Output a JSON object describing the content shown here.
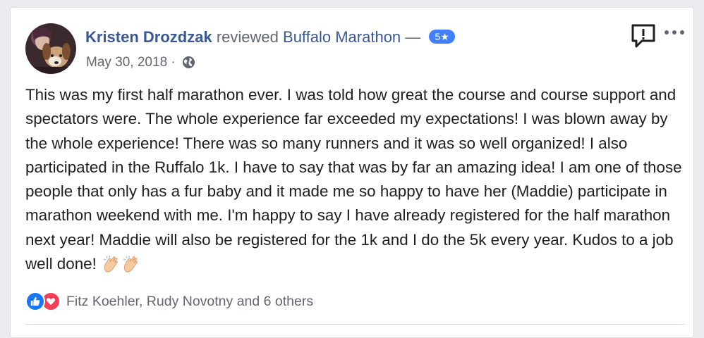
{
  "post": {
    "author": "Kristen Drozdzak",
    "action": "reviewed",
    "page": "Buffalo Marathon",
    "separator": "—",
    "rating": "5★",
    "date": "May 30, 2018",
    "date_separator": "·",
    "privacy_icon": "globe-icon",
    "body": "This was my first half marathon ever. I was told how great the course and course support and spectators were. The whole experience far exceeded my expectations! I was blown away by the whole experience! There was so many runners and it was so well organized! I also participated in the Ruffalo 1k. I have to say that was by far an amazing idea! I am one of those people that only has a fur baby and it made me so happy to have her (Maddie) participate in marathon weekend with me. I'm happy to say I have already registered for the half marathon next year! Maddie will also be registered for the 1k and I do the 5k every year. Kudos to a job well done!",
    "emoji": [
      "clapping-hands",
      "clapping-hands"
    ]
  },
  "reactions": {
    "icons": [
      "like-icon",
      "love-icon"
    ],
    "names": "Fitz Koehler, Rudy Novotny and 6 others"
  },
  "icons": {
    "report": "report-icon",
    "more": "more-icon"
  },
  "colors": {
    "link": "#385898",
    "secondary_text": "#606770",
    "badge": "#4080ff",
    "like": "#1877f2",
    "love": "#f33e58"
  }
}
